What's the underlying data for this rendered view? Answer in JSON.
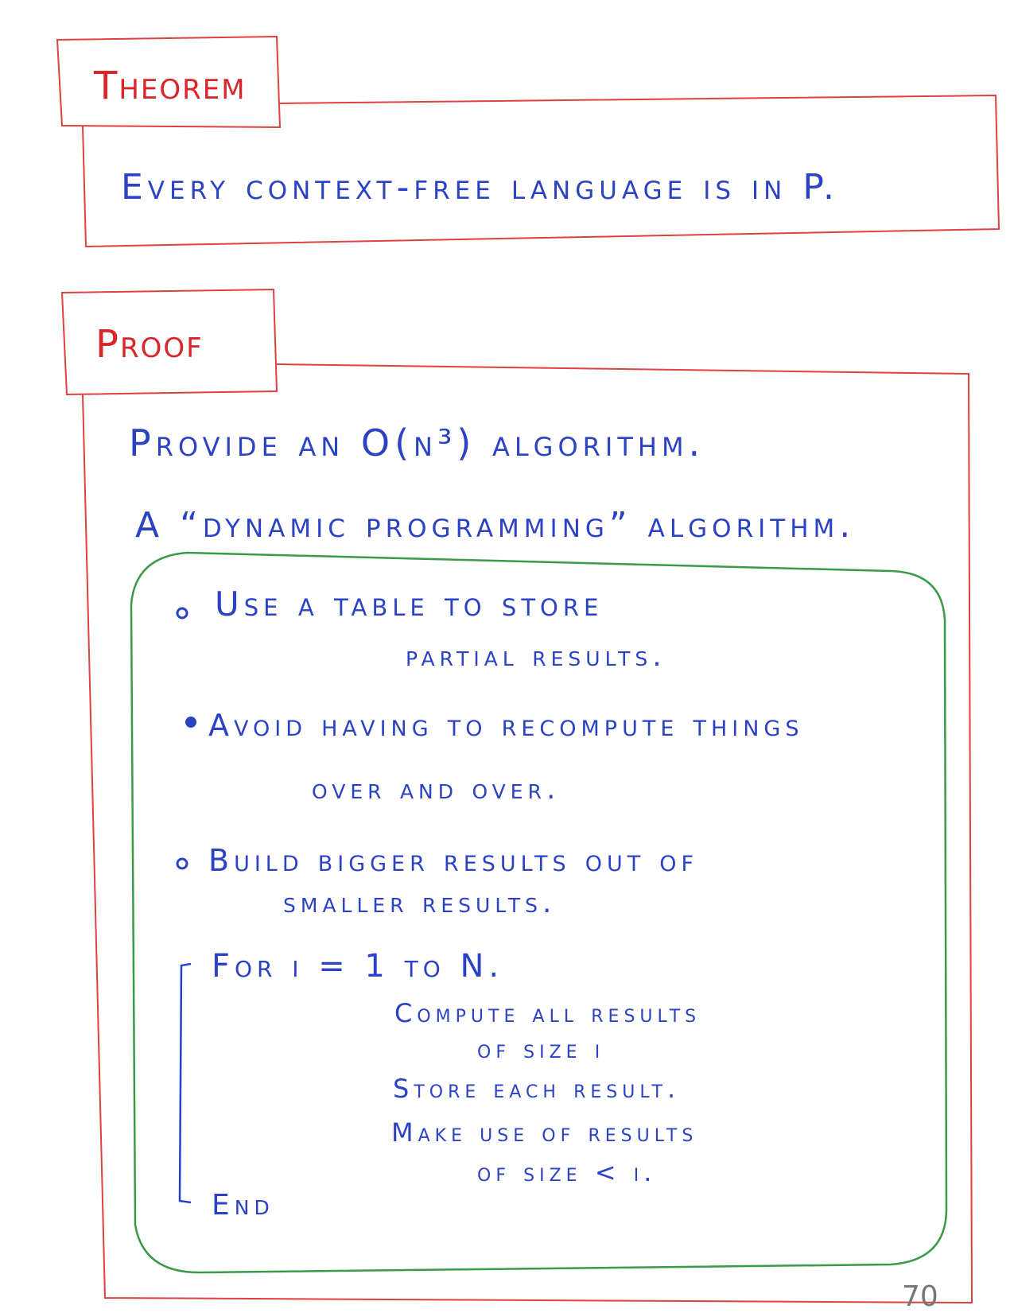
{
  "theorem": {
    "heading": "Theorem",
    "statement": "Every context-free language is in P."
  },
  "proof": {
    "heading": "Proof",
    "line1": "Provide an O(n³) algorithm.",
    "line2": "A “dynamic programming” algorithm.",
    "bullets": [
      {
        "line1": "Use a table to store",
        "line2": "partial results."
      },
      {
        "line1": "Avoid having to recompute things",
        "line2": "over and over."
      },
      {
        "line1": "Build bigger results out of",
        "line2": "smaller results."
      }
    ],
    "loop": {
      "header": "For i = 1 to N.",
      "body": [
        "Compute all results",
        "of size i",
        "Store each result.",
        "Make use of results",
        "of size < i."
      ],
      "end": "End"
    }
  },
  "page_number": "70"
}
